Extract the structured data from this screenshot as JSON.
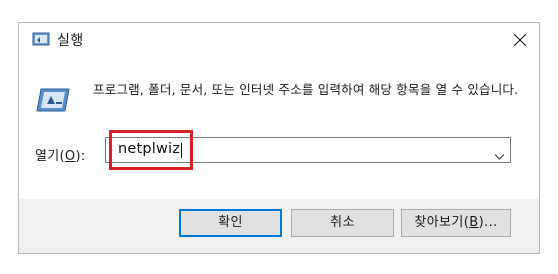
{
  "window": {
    "title": "실행",
    "icon": "run-icon",
    "close_icon": "close-icon"
  },
  "description": "프로그램, 폴더, 문서, 또는 인터넷 주소를 입력하여 해당 항목을 열 수 있습니다.",
  "open": {
    "label_prefix": "열기(",
    "label_accel": "O",
    "label_suffix": "):",
    "value": "netplwiz",
    "dropdown_icon": "chevron-down-icon"
  },
  "buttons": {
    "ok": "확인",
    "cancel": "취소",
    "browse_prefix": "찾아보기(",
    "browse_accel": "B",
    "browse_suffix": ")..."
  },
  "colors": {
    "highlight": "#d8202a",
    "default_button_border": "#0078d7",
    "footer_bg": "#f0f0f0"
  }
}
